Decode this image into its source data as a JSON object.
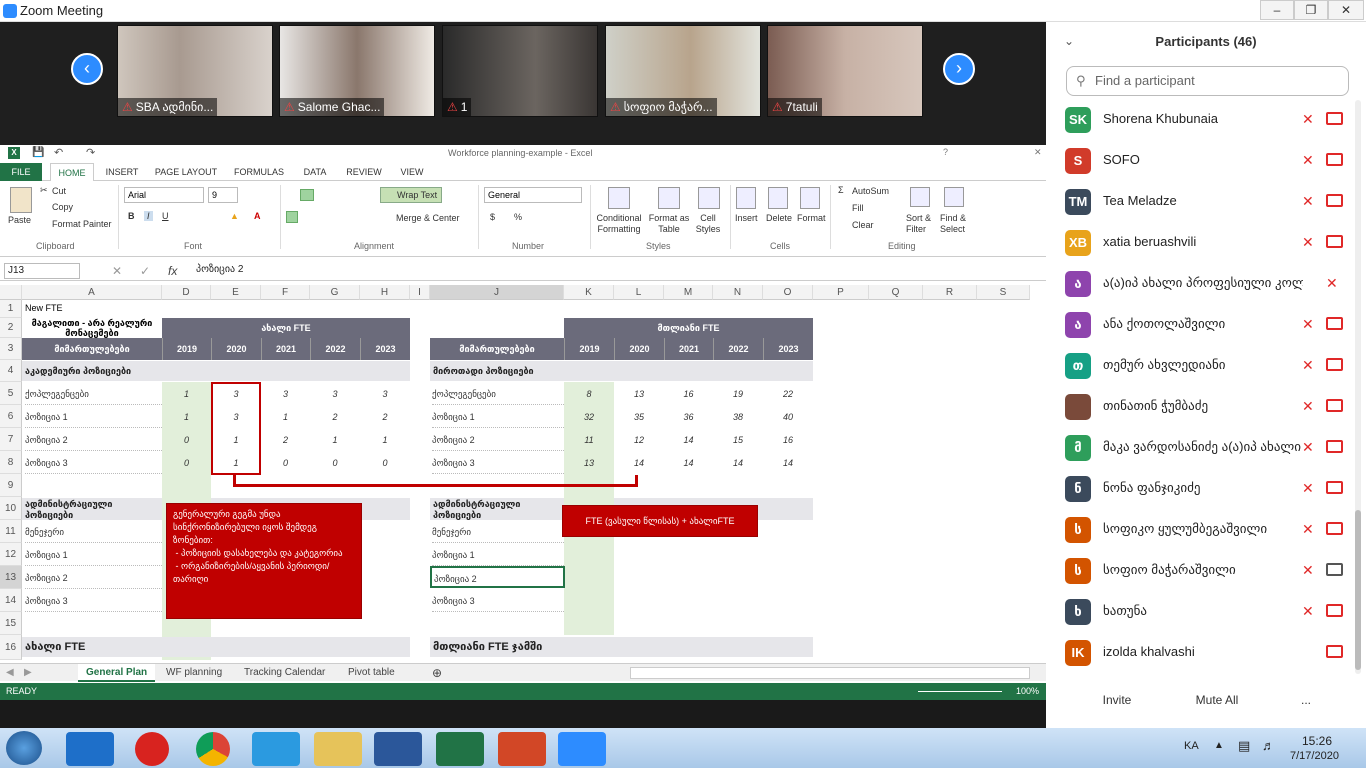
{
  "window": {
    "title": "Zoom Meeting"
  },
  "video_tiles": [
    {
      "name": "SBA ადმინი..."
    },
    {
      "name": "Salome Ghac..."
    },
    {
      "name": "1"
    },
    {
      "name": "სოფიო მაჭარ..."
    },
    {
      "name": "7tatuli"
    }
  ],
  "excel": {
    "title": "Workforce planning-example - Excel",
    "tabs": [
      "FILE",
      "HOME",
      "INSERT",
      "PAGE LAYOUT",
      "FORMULAS",
      "DATA",
      "REVIEW",
      "VIEW"
    ],
    "clipboard": {
      "paste": "Paste",
      "cut": "Cut",
      "copy": "Copy",
      "format_painter": "Format Painter",
      "group": "Clipboard"
    },
    "font": {
      "name": "Arial",
      "size": "9",
      "group": "Font"
    },
    "alignment": {
      "wrap": "Wrap Text",
      "merge": "Merge & Center",
      "group": "Alignment"
    },
    "number": {
      "format": "General",
      "group": "Number"
    },
    "styles": {
      "conditional": "Conditional Formatting",
      "format_table": "Format as Table",
      "cell_styles": "Cell Styles",
      "group": "Styles"
    },
    "cells": {
      "insert": "Insert",
      "delete": "Delete",
      "format": "Format",
      "group": "Cells"
    },
    "editing": {
      "autosum": "AutoSum",
      "fill": "Fill",
      "clear": "Clear",
      "sort": "Sort & Filter",
      "find": "Find & Select",
      "group": "Editing"
    },
    "name_box": "J13",
    "formula_value": "პოზიცია 2",
    "columns": [
      "A",
      "D",
      "E",
      "F",
      "G",
      "H",
      "I",
      "J",
      "K",
      "L",
      "M",
      "N",
      "O",
      "P",
      "Q",
      "R",
      "S"
    ],
    "rows": [
      "1",
      "2",
      "3",
      "4",
      "5",
      "6",
      "7",
      "8",
      "9",
      "10",
      "11",
      "12",
      "13",
      "14",
      "15",
      "16"
    ],
    "a1": "New FTE",
    "left_header": "ახალი FTE",
    "left_subtitle": "მაგალითი - არა რეალური მონაცემები",
    "right_header": "მთლიანი FTE",
    "col_label": "მიმართულებები",
    "years": [
      "2019",
      "2020",
      "2021",
      "2022",
      "2023"
    ],
    "left_section1": "აკადემიური პოზიციები",
    "right_section1": "მიროთადი პოზიციები",
    "left_rows": [
      {
        "label": "ქოპლეგენცები",
        "v": [
          "1",
          "3",
          "3",
          "3",
          "3"
        ]
      },
      {
        "label": "პოზიცია 1",
        "v": [
          "1",
          "3",
          "1",
          "2",
          "2"
        ]
      },
      {
        "label": "პოზიცია 2",
        "v": [
          "0",
          "1",
          "2",
          "1",
          "1"
        ]
      },
      {
        "label": "პოზიცია 3",
        "v": [
          "0",
          "1",
          "0",
          "0",
          "0"
        ]
      }
    ],
    "right_rows": [
      {
        "label": "ქოპლეგენცები",
        "v": [
          "8",
          "13",
          "16",
          "19",
          "22"
        ]
      },
      {
        "label": "პოზიცია 1",
        "v": [
          "32",
          "35",
          "36",
          "38",
          "40"
        ]
      },
      {
        "label": "პოზიცია 2",
        "v": [
          "11",
          "12",
          "14",
          "15",
          "16"
        ]
      },
      {
        "label": "პოზიცია 3",
        "v": [
          "13",
          "14",
          "14",
          "14",
          "14"
        ]
      }
    ],
    "left_section2": "ადმინისტრაციული პოზიციები",
    "right_section2": "ადმინისტრაციული პოზიციები",
    "left_rows2": [
      "მენეჯერი",
      "პოზიცია 1",
      "პოზიცია 2",
      "პოზიცია 3"
    ],
    "right_rows2": [
      "მენეჯერი",
      "პოზიცია 1",
      "პოზიცია 2",
      "პოზიცია 3"
    ],
    "row16_left": "ახალი FTE",
    "row16_right": "მთლიანი FTE ჯამში",
    "note_left": "გენერალური გეგმა უნდა სინქრონიზირებული იყოს შემდეგ ზონებით:\n - პოზიციის დასახელება და კატეგორია\n - ორგანიზირების/აყვანის პერიოდი/თარიღი",
    "note_right": "FTE (ვასული წლისას) + ახალიFTE",
    "sheets": [
      "General Plan",
      "WF planning",
      "Tracking Calendar",
      "Pivot table"
    ],
    "status": "READY",
    "zoom": "100%"
  },
  "participants": {
    "title": "Participants (46)",
    "search_placeholder": "Find a participant",
    "list": [
      {
        "initials": "SK",
        "name": "Shorena Khubunaia",
        "color": "#2e9e5b",
        "cam": "off"
      },
      {
        "initials": "S",
        "name": "SOFO",
        "color": "#d13b2a",
        "cam": "off"
      },
      {
        "initials": "TM",
        "name": "Tea Meladze",
        "color": "#3b4a5c",
        "cam": "off"
      },
      {
        "initials": "XB",
        "name": "xatia beruashvili",
        "color": "#e8a31b",
        "cam": "off"
      },
      {
        "initials": "ა",
        "name": "ა(ა)იპ ახალი პროფესიული კოლეჯი",
        "color": "#8e44ad",
        "cam": "none"
      },
      {
        "initials": "ა",
        "name": "ანა ქოთოლაშვილი",
        "color": "#8e44ad",
        "cam": "off"
      },
      {
        "initials": "თ",
        "name": "თემურ ახვლედიანი",
        "color": "#16a085",
        "cam": "off"
      },
      {
        "initials": "",
        "name": "თინათინ ჭუმბაძე",
        "color": "#7a4a3a",
        "cam": "off"
      },
      {
        "initials": "მ",
        "name": "მაკა ვარდოსანიძე ა(ა)იპ ახალი პ...",
        "color": "#2e9e5b",
        "cam": "off"
      },
      {
        "initials": "ნ",
        "name": "ნონა ფანჯიკიძე",
        "color": "#3b4a5c",
        "cam": "off"
      },
      {
        "initials": "ს",
        "name": "სოფიკო ყულუმბეგაშვილი",
        "color": "#d35400",
        "cam": "off"
      },
      {
        "initials": "ს",
        "name": "სოფიო მაჭარაშვილი",
        "color": "#d35400",
        "cam": "on"
      },
      {
        "initials": "ხ",
        "name": "ხათუნა",
        "color": "#3b4a5c",
        "cam": "off"
      },
      {
        "initials": "IK",
        "name": "izolda khalvashi",
        "color": "#d35400",
        "cam": "none2"
      }
    ],
    "invite": "Invite",
    "mute_all": "Mute All",
    "more": "..."
  },
  "taskbar": {
    "lang": "KA",
    "time": "15:26",
    "date": "7/17/2020"
  }
}
